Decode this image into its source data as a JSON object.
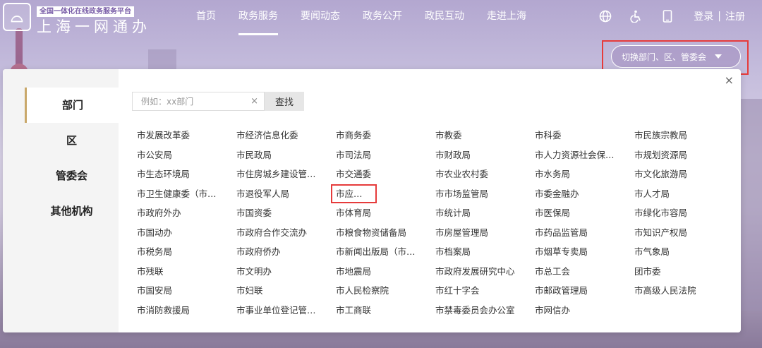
{
  "header": {
    "logo_tag": "全国一体化在线政务服务平台",
    "logo_name": "上海一网通办",
    "nav": [
      "首页",
      "政务服务",
      "要闻动态",
      "政务公开",
      "政民互动",
      "走进上海"
    ],
    "active_nav": "政务服务",
    "login": "登录",
    "separator": "|",
    "register": "注册"
  },
  "switch_button": {
    "label": "切换部门、区、管委会"
  },
  "panel": {
    "close": "×",
    "side_tabs": [
      "部门",
      "区",
      "管委会",
      "其他机构"
    ],
    "active_tab": "部门",
    "search": {
      "placeholder": "例如：xx部门",
      "clear": "×",
      "button": "查找"
    },
    "departments": [
      "市发展改革委",
      "市经济信息化委",
      "市商务委",
      "市教委",
      "市科委",
      "市民族宗教局",
      "市公安局",
      "市民政局",
      "市司法局",
      "市财政局",
      "市人力资源社会保…",
      "市规划资源局",
      "市生态环境局",
      "市住房城乡建设管…",
      "市交通委",
      "市农业农村委",
      "市水务局",
      "市文化旅游局",
      "市卫生健康委（市…",
      "市退役军人局",
      "市应急局",
      "市市场监管局",
      "市委金融办",
      "市人才局",
      "市政府外办",
      "市国资委",
      "市体育局",
      "市统计局",
      "市医保局",
      "市绿化市容局",
      "市国动办",
      "市政府合作交流办",
      "市粮食物资储备局",
      "市房屋管理局",
      "市药品监管局",
      "市知识产权局",
      "市税务局",
      "市政府侨办",
      "市新闻出版局（市…",
      "市档案局",
      "市烟草专卖局",
      "市气象局",
      "市残联",
      "市文明办",
      "市地震局",
      "市政府发展研究中心",
      "市总工会",
      "团市委",
      "市国安局",
      "市妇联",
      "市人民检察院",
      "市红十字会",
      "市邮政管理局",
      "市高级人民法院",
      "市消防救援局",
      "市事业单位登记管…",
      "市工商联",
      "市禁毒委员会办公室",
      "市网信办"
    ],
    "highlighted": "市应急局"
  },
  "icons": {
    "globe": "globe-icon",
    "accessibility": "accessibility-icon",
    "mobile": "mobile-icon"
  }
}
